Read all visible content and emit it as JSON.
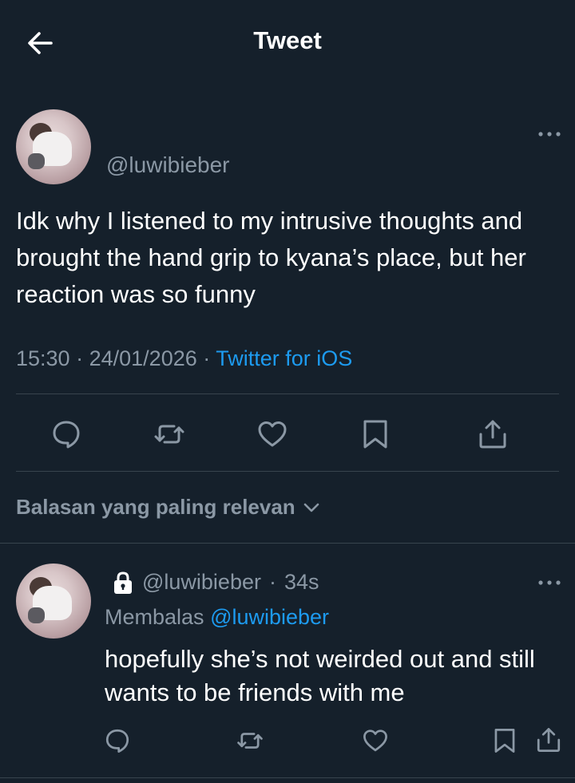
{
  "header": {
    "title": "Tweet",
    "back_icon": "arrow-left-icon"
  },
  "tweet": {
    "handle": "@luwibieber",
    "text": "Idk why I listened to my intrusive thoughts and brought the hand grip to kyana’s place, but her reaction was so funny",
    "time": "15:30",
    "date": "24/01/2026",
    "separator": "·",
    "source": "Twitter for iOS",
    "actions": [
      "reply-icon",
      "retweet-icon",
      "like-icon",
      "bookmark-icon",
      "share-icon"
    ]
  },
  "sort": {
    "label": "Balasan yang paling relevan",
    "icon": "chevron-down-icon"
  },
  "reply": {
    "handle": "@luwibieber",
    "separator": "·",
    "age": "34s",
    "replying_prefix": "Membalas",
    "replying_to": "@luwibieber",
    "text": "hopefully she’s not weirded out and still wants to be friends with me",
    "protected_icon": "lock-icon",
    "actions": [
      "reply-icon",
      "retweet-icon",
      "like-icon",
      "bookmark-icon",
      "share-icon"
    ]
  },
  "colors": {
    "background": "#15202b",
    "text": "#ffffff",
    "secondary": "#8b98a5",
    "accent": "#1d9bf0",
    "divider": "#38444d"
  }
}
